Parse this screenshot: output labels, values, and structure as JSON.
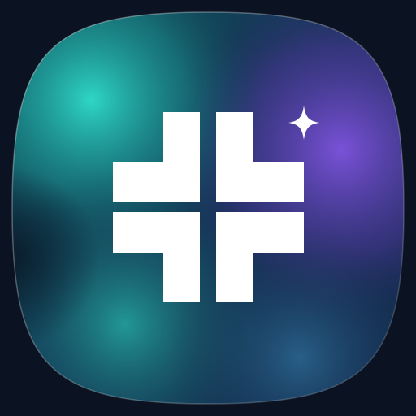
{
  "icon": {
    "name": "app-icon",
    "glyph": "cross-plus-icon",
    "accent_glyph": "sparkle-icon",
    "colors": {
      "page_background": "#0b1322",
      "teal": "#2bd4c3",
      "deep_teal": "#0d4a52",
      "violet": "#6a4ad0",
      "navy": "#16234a",
      "glyph": "#ffffff"
    }
  }
}
